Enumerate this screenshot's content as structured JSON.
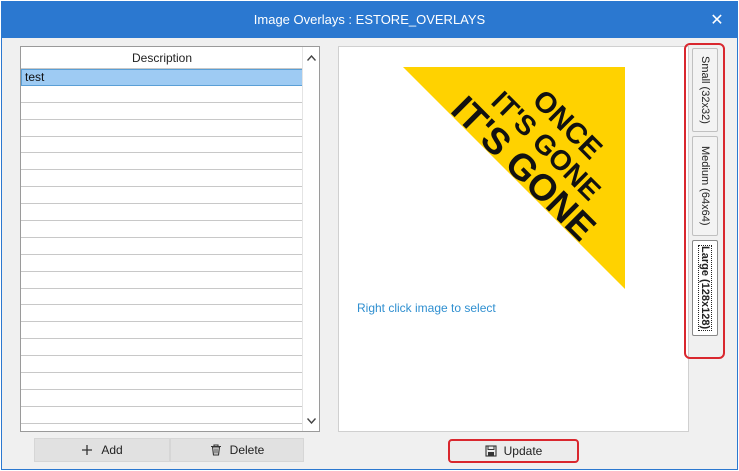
{
  "window": {
    "title": "Image Overlays : ESTORE_OVERLAYS",
    "close_symbol": "✕"
  },
  "list": {
    "header": "Description",
    "rows": [
      "test",
      "",
      "",
      "",
      "",
      "",
      "",
      "",
      "",
      "",
      "",
      "",
      "",
      "",
      "",
      "",
      "",
      "",
      "",
      "",
      ""
    ],
    "selected_index": 0
  },
  "buttons": {
    "add_label": "Add",
    "add_icon": "plus-icon",
    "delete_label": "Delete",
    "delete_icon": "trash-icon",
    "update_label": "Update",
    "update_icon": "save-icon"
  },
  "preview": {
    "overlay_text_line1": "ONCE",
    "overlay_text_line2": "IT'S GONE",
    "overlay_text_line3": "IT'S GONE",
    "overlay_color": "#ffd200",
    "hint": "Right click image to select"
  },
  "size_tabs": [
    {
      "label": "Small (32x32)",
      "active": false
    },
    {
      "label": "Medium (64x64)",
      "active": false
    },
    {
      "label": "Large (128x128)",
      "active": true
    }
  ],
  "colors": {
    "titlebar": "#2b78d0",
    "highlight": "#d9272e",
    "hint": "#2f8fd0",
    "selected_row": "#9ecbf3"
  }
}
